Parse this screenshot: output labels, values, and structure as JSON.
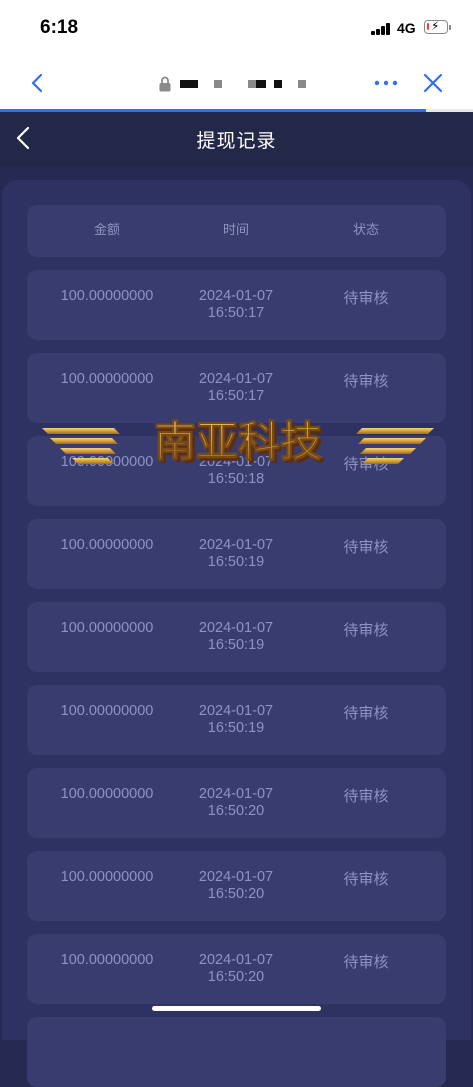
{
  "status_bar": {
    "time": "6:18",
    "network": "4G",
    "battery_level": 0.12,
    "battery_color": "#ff3b30"
  },
  "browser": {
    "page_load_progress": 0.9,
    "accent_color": "#2f6ef6",
    "icons": [
      "back-chevron-icon",
      "lock-icon",
      "more-icon",
      "close-icon"
    ]
  },
  "header": {
    "title": "提现记录"
  },
  "table": {
    "columns": [
      "金额",
      "时间",
      "状态"
    ],
    "rows": [
      {
        "amount": "100.00000000",
        "date": "2024-01-07",
        "time": "16:50:17",
        "status": "待审核"
      },
      {
        "amount": "100.00000000",
        "date": "2024-01-07",
        "time": "16:50:17",
        "status": "待审核"
      },
      {
        "amount": "100.00000000",
        "date": "2024-01-07",
        "time": "16:50:18",
        "status": "待审核"
      },
      {
        "amount": "100.00000000",
        "date": "2024-01-07",
        "time": "16:50:19",
        "status": "待审核"
      },
      {
        "amount": "100.00000000",
        "date": "2024-01-07",
        "time": "16:50:19",
        "status": "待审核"
      },
      {
        "amount": "100.00000000",
        "date": "2024-01-07",
        "time": "16:50:19",
        "status": "待审核"
      },
      {
        "amount": "100.00000000",
        "date": "2024-01-07",
        "time": "16:50:20",
        "status": "待审核"
      },
      {
        "amount": "100.00000000",
        "date": "2024-01-07",
        "time": "16:50:20",
        "status": "待审核"
      },
      {
        "amount": "100.00000000",
        "date": "2024-01-07",
        "time": "16:50:20",
        "status": "待审核"
      }
    ]
  },
  "watermark": {
    "text": "南亚科技",
    "color": "#d4a23c"
  },
  "theme": {
    "page_bg": "#262a52",
    "card_bg": "#2e3262",
    "row_bg": "#383c6e",
    "text_muted": "#8e93c6"
  }
}
